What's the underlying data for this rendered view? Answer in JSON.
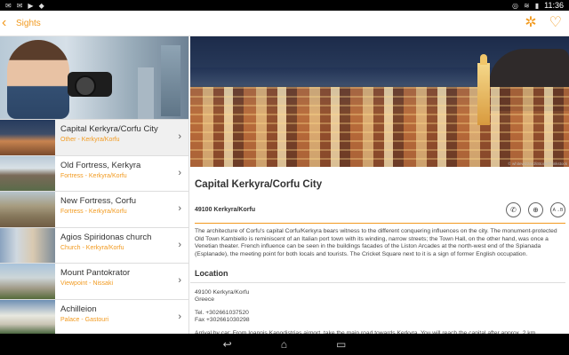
{
  "status_bar": {
    "time": "11:36",
    "left_icons": [
      "notification-icon",
      "notification-icon",
      "play-store-icon",
      "android-icon"
    ],
    "right_icons": [
      "nfc-icon",
      "wifi-icon",
      "battery-icon"
    ]
  },
  "app_bar": {
    "title": "Sights",
    "accent": "#f29a1f",
    "back_icon": "chevron-left-icon",
    "actions": [
      {
        "name": "compass-icon",
        "glyph": "✲"
      },
      {
        "name": "heart-icon",
        "glyph": "♡"
      }
    ]
  },
  "list": {
    "items": [
      {
        "title": "Capital Kerkyra/Corfu City",
        "subtitle": "Other - Kerkyra/Korfu",
        "active": true,
        "thumb": "linear-gradient(180deg,#263b5e 0%,#3d4d68 40%,#c88450 60%,#7a4a2c 100%)"
      },
      {
        "title": "Old Fortress, Kerkyra",
        "subtitle": "Fortress - Kerkyra/Korfu",
        "active": false,
        "thumb": "linear-gradient(180deg,#b9c9d6 0%,#d9e1e6 35%,#7a6a58 55%,#5a6b4a 100%)"
      },
      {
        "title": "New Fortress, Corfu",
        "subtitle": "Fortress - Kerkyra/Korfu",
        "active": false,
        "thumb": "linear-gradient(180deg,#b7c4cc 0%,#a79c80 40%,#85765a 70%,#6f5c44 100%)"
      },
      {
        "title": "Agios Spiridonas church",
        "subtitle": "Church - Kerkyra/Korfu",
        "active": false,
        "thumb": "linear-gradient(90deg,#8aa3bf 0%,#cfd8e0 30%,#d9c9b0 60%,#7e8d99 100%)"
      },
      {
        "title": "Mount Pantokrator",
        "subtitle": "Viewpoint - Nissaki",
        "active": false,
        "thumb": "linear-gradient(180deg,#a8c2da 0%,#cdd6d8 40%,#a09a86 70%,#556b3a 100%)"
      },
      {
        "title": "Achilleion",
        "subtitle": "Palace - Gastouri",
        "active": false,
        "thumb": "linear-gradient(180deg,#6f8fb4 0%,#e8e8e0 45%,#c9c5b5 70%,#3f5f34 100%)"
      }
    ]
  },
  "detail": {
    "photo_credit": "© whitewizzard/iStock/Thinkstock",
    "title": "Capital Kerkyra/Corfu City",
    "address_line": "49100 Kerkyra/Korfu",
    "action_icons": [
      {
        "name": "phone-icon",
        "glyph": "✆"
      },
      {
        "name": "globe-icon",
        "glyph": "⊕"
      },
      {
        "name": "directions-icon",
        "glyph": "A→B"
      }
    ],
    "body": "The architecture of Corfu's capital Corfu/Kerkyra bears witness to the different conquering influences on the city. The monument-protected Old Town Kambiello is reminiscent of an Italian port town with its winding, narrow streets; the Town Hall, on the other hand, was once a Venetian theater. French influence can be seen in the buildings facades of the Liston Arcades at the north-west end of the Spianada (Esplanade), the meeting point for both locals and tourists. The Cricket Square next to it is a sign of former English occupation.",
    "location_header": "Location",
    "location_address_1": "49100 Kerkyra/Korfu",
    "location_address_2": "Greece",
    "tel": "Tel. +302661037520",
    "fax": "Fax +302661030298",
    "arrival": "Arrival by car: From Ioannis Kapodistrias airport, take the main road towards Kerkyra. You will reach the capital after approx. 2 km."
  },
  "nav_bar": {
    "buttons": [
      {
        "name": "back-nav-button",
        "glyph": "↩"
      },
      {
        "name": "home-nav-button",
        "glyph": "⌂"
      },
      {
        "name": "recents-nav-button",
        "glyph": "▭"
      }
    ]
  }
}
